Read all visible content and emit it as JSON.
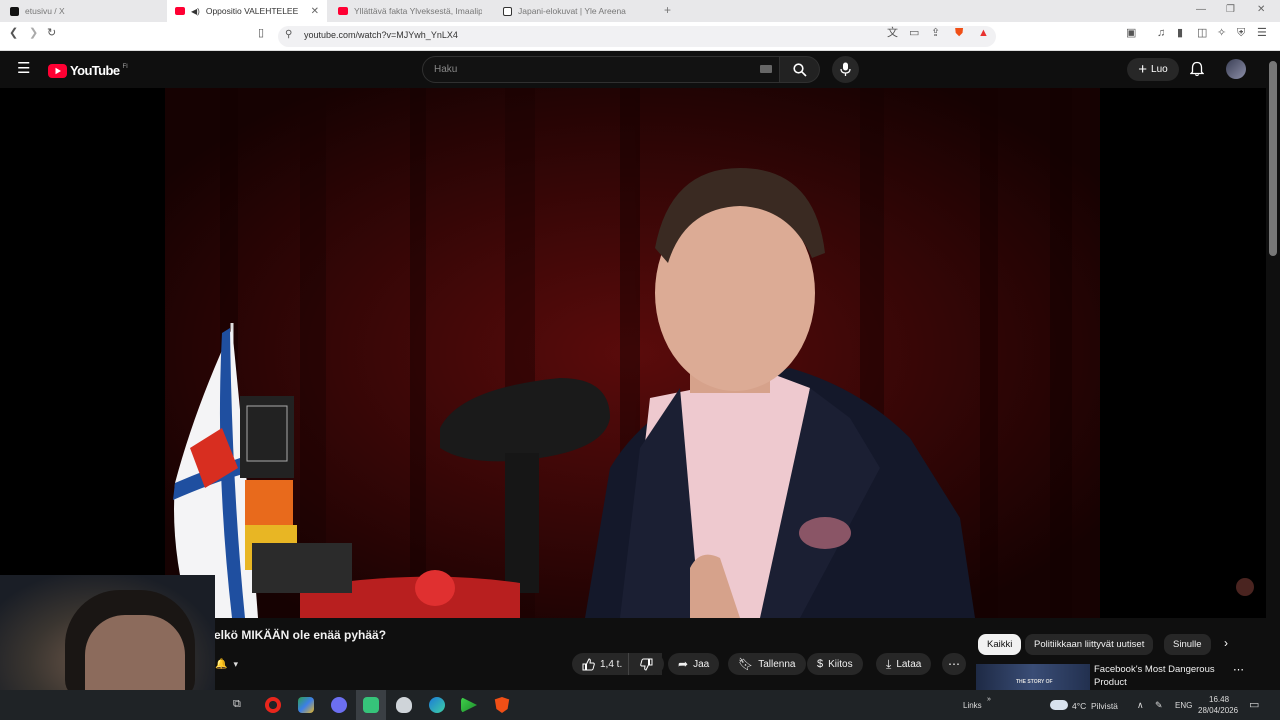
{
  "browser": {
    "tabs": [
      {
        "title": "etusivu / X",
        "active": false
      },
      {
        "title": "Oppositio VALEHTELEE jälleen",
        "active": true
      },
      {
        "title": "Yllättävä fakta Ylveksestä, Imaalipan...",
        "active": false
      },
      {
        "title": "Japani-elokuvat | Yle Areena",
        "active": false
      }
    ],
    "new_tab": "+",
    "url": "youtube.com/watch?v=MJYwh_YnLX4",
    "window_controls": [
      "—",
      "❐",
      "✕"
    ]
  },
  "youtube": {
    "logo_text": "YouTube",
    "region": "FI",
    "search_placeholder": "Haku",
    "create_label": "Luo"
  },
  "video": {
    "title": "elkö MIKÄÄN ole enää pyhää?",
    "likes": "1,4 t.",
    "actions": {
      "share": "Jaa",
      "save": "Tallenna",
      "thanks": "Kiitos",
      "download": "Lataa"
    }
  },
  "recommendations": {
    "chips": [
      "Kaikki",
      "Politiikkaan liittyvät uutiset",
      "Sinulle"
    ],
    "first_item_title": "Facebook's Most Dangerous Product",
    "thumb_text": "THE STORY OF"
  },
  "taskbar": {
    "links_label": "Links",
    "weather": "4°C  Pilvistä",
    "language": "ENG",
    "time": "16.48",
    "date": "28/04/2026"
  },
  "colors": {
    "youtube_red": "#ff0033",
    "dark_bg": "#0f0f0f",
    "chip_bg": "#272727",
    "active_chip": "#f1f1f1"
  }
}
